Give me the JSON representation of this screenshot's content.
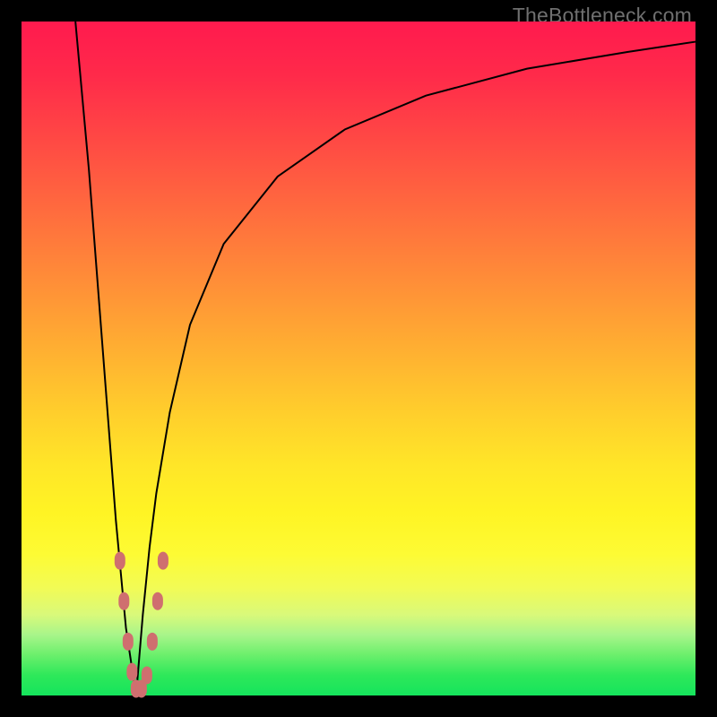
{
  "watermark": "TheBottleneck.com",
  "colors": {
    "frame": "#000000",
    "gradient_top": "#ff1a4e",
    "gradient_bottom": "#15e45c",
    "curve": "#000000",
    "marker": "#cf6f6f"
  },
  "chart_data": {
    "type": "line",
    "title": "",
    "xlabel": "",
    "ylabel": "",
    "xlim": [
      0,
      100
    ],
    "ylim": [
      0,
      100
    ],
    "note": "No axis ticks or numeric labels are drawn; values below are approximate percentages estimated from curve shape.",
    "series": [
      {
        "name": "left-descent",
        "x": [
          8,
          10,
          12,
          14,
          15.5,
          17
        ],
        "values": [
          100,
          78,
          52,
          26,
          10,
          0
        ]
      },
      {
        "name": "right-ascent",
        "x": [
          17,
          18,
          19,
          20,
          22,
          25,
          30,
          38,
          48,
          60,
          75,
          90,
          100
        ],
        "values": [
          0,
          12,
          22,
          30,
          42,
          55,
          67,
          77,
          84,
          89,
          93,
          95.5,
          97
        ]
      }
    ],
    "markers": [
      {
        "x": 14.6,
        "y": 20
      },
      {
        "x": 15.2,
        "y": 14
      },
      {
        "x": 15.8,
        "y": 8
      },
      {
        "x": 16.4,
        "y": 3.5
      },
      {
        "x": 17.0,
        "y": 1
      },
      {
        "x": 17.8,
        "y": 1
      },
      {
        "x": 18.6,
        "y": 3
      },
      {
        "x": 19.4,
        "y": 8
      },
      {
        "x": 20.2,
        "y": 14
      },
      {
        "x": 21.0,
        "y": 20
      }
    ]
  }
}
